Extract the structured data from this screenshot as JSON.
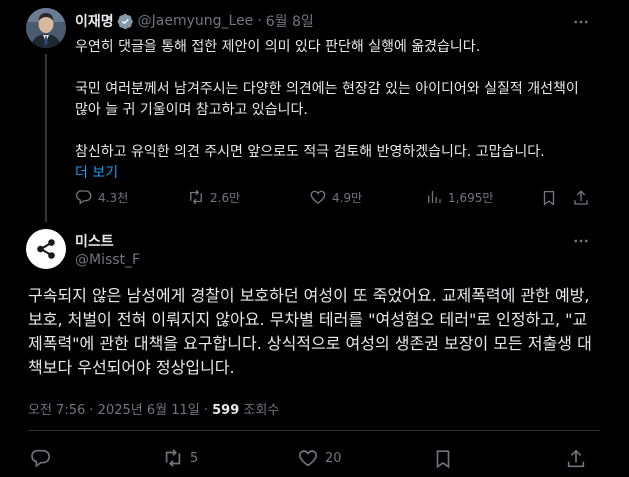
{
  "tweet1": {
    "display_name": "이재명",
    "handle": "@Jaemyung_Lee",
    "separator": "·",
    "date": "6월 8일",
    "paragraphs": [
      "우연히 댓글을 통해 접한 제안이 의미 있다 판단해 실행에 옮겼습니다.",
      "국민 여러분께서 남겨주시는 다양한 의견에는 현장감 있는 아이디어와 실질적 개선책이 많아 늘 귀 기울이며 참고하고 있습니다.",
      "참신하고 유익한 의견 주시면 앞으로도 적극 검토해 반영하겠습니다. 고맙습니다."
    ],
    "show_more": "더 보기",
    "stats": {
      "replies": "4.3천",
      "retweets": "2.6만",
      "likes": "4.9만",
      "views": "1,695만"
    }
  },
  "tweet2": {
    "display_name": "미스트",
    "handle": "@Misst_F",
    "text": "구속되지 않은 남성에게 경찰이 보호하던 여성이 또 죽었어요. 교제폭력에 관한 예방, 보호, 처벌이 전혀 이뤄지지 않아요. 무차별 테러를 \"여성혐오 테러\"로 인정하고, \"교제폭력\"에 관한 대책을 요구합니다. 상식적으로 여성의 생존권 보장이 모든 저출생 대책보다 우선되어야 정상입니다.",
    "meta": {
      "time": "오전 7:56",
      "dot": "·",
      "date": "2025년 6월 11일",
      "dot2": "·",
      "views_count": "599",
      "views_label": "조회수"
    },
    "stats": {
      "retweets": "5",
      "likes": "20"
    }
  },
  "icons": {
    "verified": "verified-badge-icon",
    "more": "more-options-icon",
    "reply": "reply-icon",
    "retweet": "retweet-icon",
    "like": "heart-icon",
    "views": "views-icon",
    "bookmark": "bookmark-icon",
    "share": "share-icon",
    "avatar2": "share-logo-icon"
  },
  "colors": {
    "background": "#000000",
    "text": "#e7e9ea",
    "muted": "#71767b",
    "accent": "#1d9bf0",
    "divider": "#2f3336"
  }
}
